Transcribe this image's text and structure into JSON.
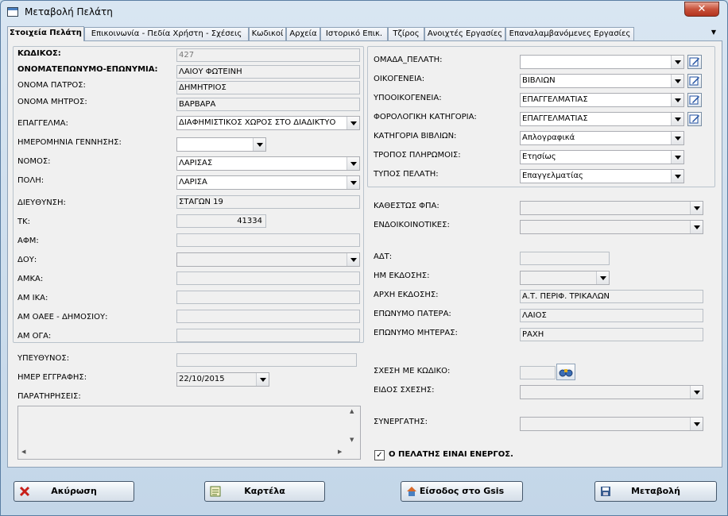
{
  "window": {
    "title": "Μεταβολή Πελάτη",
    "close_label": "✕"
  },
  "tabs": [
    {
      "label": "Στοιχεία Πελάτη",
      "active": true
    },
    {
      "label": "Επικοινωνία - Πεδία Χρήστη - Σχέσεις",
      "active": false
    },
    {
      "label": "Κωδικοί",
      "active": false
    },
    {
      "label": "Αρχεία",
      "active": false
    },
    {
      "label": "Ιστορικό Επικ.",
      "active": false
    },
    {
      "label": "Τζίρος",
      "active": false
    },
    {
      "label": "Ανοιχτές Εργασίες",
      "active": false
    },
    {
      "label": "Επαναλαμβανόμενες Εργασίες",
      "active": false
    }
  ],
  "left": {
    "code": {
      "label": "ΚΩΔΙΚΟΣ:",
      "value": "427"
    },
    "fullname": {
      "label": "ΟΝΟΜΑΤΕΠΩΝΥΜΟ-ΕΠΩΝΥΜΙΑ:",
      "value": "ΛΑΙΟΥ ΦΩΤΕΙΝΗ"
    },
    "father": {
      "label": "ΟΝΟΜΑ ΠΑΤΡΟΣ:",
      "value": "ΔΗΜΗΤΡΙΟΣ"
    },
    "mother": {
      "label": "ΟΝΟΜΑ ΜΗΤΡΟΣ:",
      "value": "ΒΑΡΒΑΡΑ"
    },
    "profession": {
      "label": "ΕΠΑΓΓΕΛΜΑ:",
      "value": "ΔΙΑΦΗΜΙΣΤΙΚΟΣ ΧΩΡΟΣ ΣΤΟ ΔΙΑΔΙΚΤΥΟ"
    },
    "birthdate": {
      "label": "ΗΜΕΡΟΜΗΝΙΑ ΓΕΝΝΗΣΗΣ:",
      "value": ""
    },
    "prefecture": {
      "label": "ΝΟΜΟΣ:",
      "value": "ΛΑΡΙΣΑΣ"
    },
    "city": {
      "label": "ΠΟΛΗ:",
      "value": "ΛΑΡΙΣΑ"
    },
    "address": {
      "label": "ΔΙΕΥΘΥΝΣΗ:",
      "value": "ΣΤΑΓΩΝ 19"
    },
    "zip": {
      "label": "ΤΚ:",
      "value": "41334"
    },
    "afm": {
      "label": "ΑΦΜ:",
      "value": ""
    },
    "doy": {
      "label": "ΔΟΥ:",
      "value": ""
    },
    "amka": {
      "label": "ΑΜΚΑ:",
      "value": ""
    },
    "amika": {
      "label": "ΑΜ ΙΚΑ:",
      "value": ""
    },
    "oaee": {
      "label": "ΑΜ ΟΑΕΕ - ΔΗΜΟΣΙΟΥ:",
      "value": ""
    },
    "oga": {
      "label": "ΑΜ ΟΓΑ:",
      "value": ""
    },
    "responsible": {
      "label": "ΥΠΕΥΘΥΝΟΣ:",
      "value": ""
    },
    "regdate": {
      "label": "ΗΜΕΡ ΕΓΓΡΑΦΗΣ:",
      "value": "22/10/2015"
    },
    "notes": {
      "label": "ΠΑΡΑΤΗΡΗΣΕΙΣ:",
      "value": ""
    }
  },
  "right": {
    "group": {
      "label": "ΟΜΑΔΑ_ΠΕΛΑΤΗ:",
      "value": ""
    },
    "family": {
      "label": "ΟΙΚΟΓΕΝΕΙΑ:",
      "value": "ΒΙΒΛΙΩΝ"
    },
    "subfamily": {
      "label": "ΥΠΟΟΙΚΟΓΕΝΕΙΑ:",
      "value": "ΕΠΑΓΓΕΛΜΑΤΙΑΣ"
    },
    "taxcat": {
      "label": "ΦΟΡΟΛΟΓΙΚΗ ΚΑΤΗΓΟΡΙΑ:",
      "value": "ΕΠΑΓΓΕΛΜΑΤΙΑΣ"
    },
    "bookcat": {
      "label": "ΚΑΤΗΓΟΡΙΑ ΒΙΒΛΙΩΝ:",
      "value": "Απλογραφικά"
    },
    "payment": {
      "label": "ΤΡΟΠΟΣ ΠΛΗΡΩΜΟΙΣ:",
      "value": "Ετησίως"
    },
    "custtype": {
      "label": "ΤΥΠΟΣ ΠΕΛΑΤΗ:",
      "value": "Επαγγελματίας"
    },
    "vat": {
      "label": "ΚΑΘΕΣΤΩΣ ΦΠΑ:",
      "value": ""
    },
    "intra": {
      "label": "ΕΝΔΟΙΚΟΙΝΟΤΙΚΕΣ:",
      "value": ""
    },
    "adt": {
      "label": "ΑΔΤ:",
      "value": ""
    },
    "issuedate": {
      "label": "ΗΜ ΕΚΔΟΣΗΣ:",
      "value": ""
    },
    "authority": {
      "label": "ΑΡΧΗ ΕΚΔΟΣΗΣ:",
      "value": "Α.Τ. ΠΕΡΙΦ. ΤΡΙΚΑΛΩΝ"
    },
    "fathersurname": {
      "label": "ΕΠΩΝΥΜΟ ΠΑΤΕΡΑ:",
      "value": "ΛΑΙΟΣ"
    },
    "mothersurname": {
      "label": "ΕΠΩΝΥΜΟ ΜΗΤΕΡΑΣ:",
      "value": "ΡΑΧΗ"
    },
    "relcode": {
      "label": "ΣΧΕΣΗ ΜΕ ΚΩΔΙΚΟ:",
      "value": ""
    },
    "reltype": {
      "label": "ΕΙΔΟΣ ΣΧΕΣΗΣ:",
      "value": ""
    },
    "partner": {
      "label": "ΣΥΝΕΡΓΑΤΗΣ:",
      "value": ""
    },
    "active": {
      "label": "Ο ΠΕΛΑΤΗΣ ΕΙΝΑΙ ΕΝΕΡΓΟΣ.",
      "checked": true,
      "mark": "✓"
    }
  },
  "buttons": {
    "cancel": "Ακύρωση",
    "card": "Καρτέλα",
    "gsis": "Είσοδος στο Gsis",
    "save": "Μεταβολή"
  },
  "colors": {
    "accent": "#4a80c0",
    "close": "#c8523b",
    "edit_pen": "#1f4fa0"
  }
}
